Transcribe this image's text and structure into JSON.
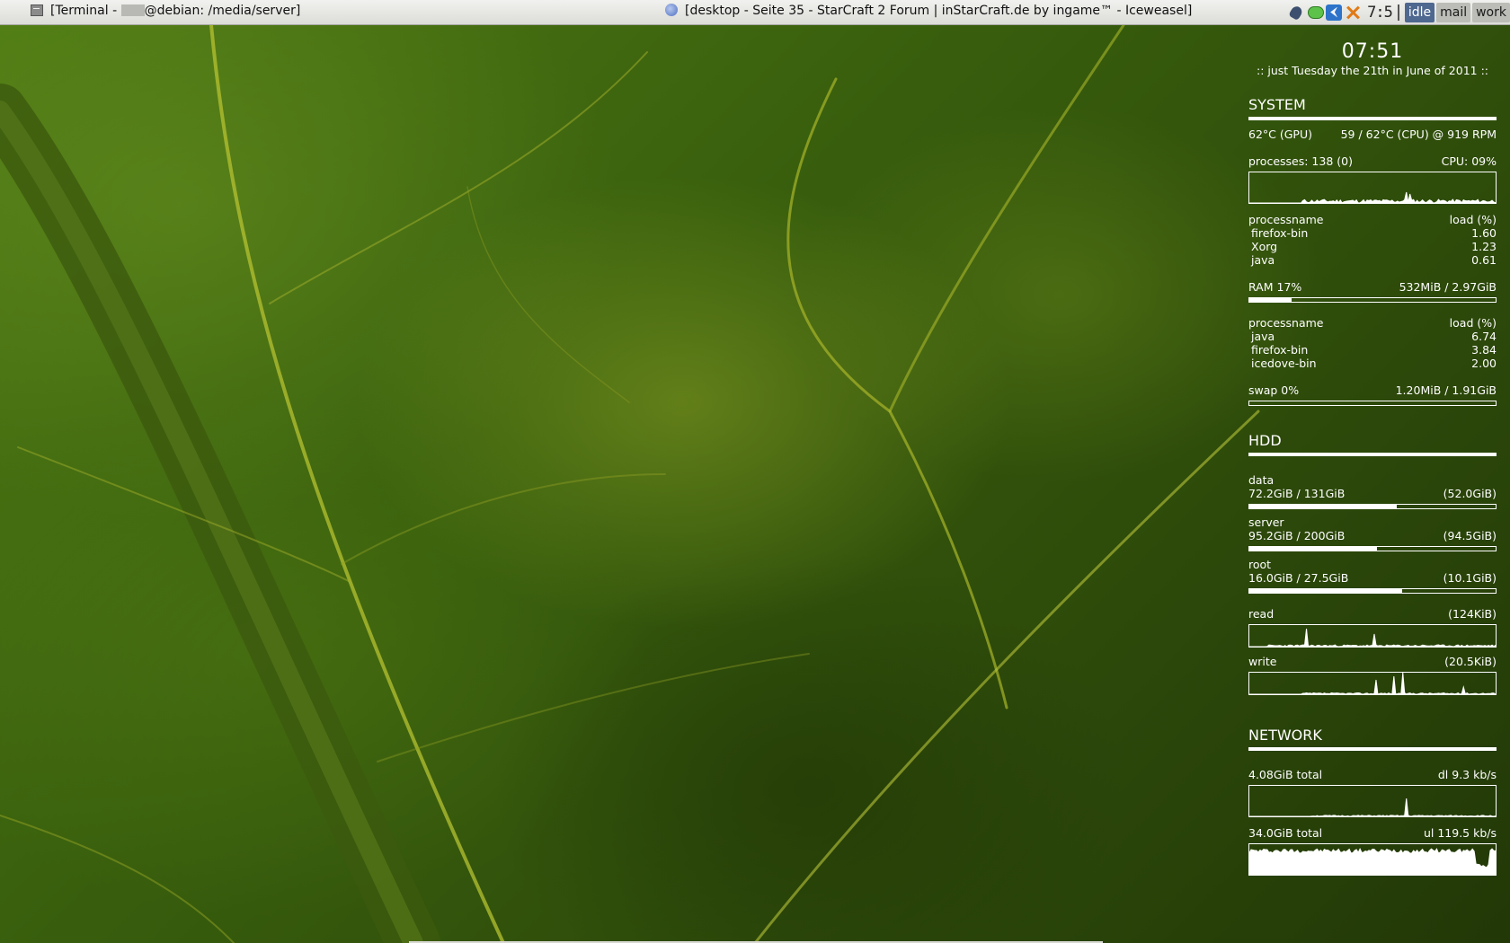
{
  "taskbar": {
    "terminal_title_prefix": "[Terminal - ",
    "terminal_title_suffix": "@debian: /media/server]",
    "browser_title": "[desktop - Seite 35 - StarCraft 2 Forum | inStarCraft.de by ingame™ - Iceweasel]"
  },
  "tray": {
    "clock": "7:5",
    "icons": [
      "wrench-icon",
      "chat-icon",
      "thunderbird-icon",
      "cross-icon"
    ],
    "tags": [
      {
        "label": "idle",
        "active": true
      },
      {
        "label": "mail",
        "active": false
      },
      {
        "label": "work",
        "active": false
      }
    ]
  },
  "conky": {
    "time": "07:51",
    "date": ":: just Tuesday the 21th in June of 2011 ::",
    "system": {
      "title": "SYSTEM",
      "gpu_temp": "62°C (GPU)",
      "cpu_temp": "59 / 62°C (CPU) @ 919 RPM",
      "processes": "processes: 138 (0)",
      "cpu": "CPU: 09%",
      "cpu_header": {
        "name": "processname",
        "load": "load (%)"
      },
      "cpu_procs": [
        {
          "name": "firefox-bin",
          "load": "1.60"
        },
        {
          "name": "Xorg",
          "load": "1.23"
        },
        {
          "name": "java",
          "load": "0.61"
        }
      ],
      "ram_label": "RAM 17%",
      "ram_value": "532MiB / 2.97GiB",
      "ram_pct": 17,
      "mem_header": {
        "name": "processname",
        "load": "load (%)"
      },
      "mem_procs": [
        {
          "name": "java",
          "load": "6.74"
        },
        {
          "name": "firefox-bin",
          "load": "3.84"
        },
        {
          "name": "icedove-bin",
          "load": "2.00"
        }
      ],
      "swap_label": "swap 0%",
      "swap_value": "1.20MiB / 1.91GiB",
      "swap_pct": 0
    },
    "hdd": {
      "title": "HDD",
      "disks": [
        {
          "name": "data",
          "usage": "72.2GiB / 131GiB",
          "free": "(52.0GiB)",
          "pct": 60
        },
        {
          "name": "server",
          "usage": "95.2GiB / 200GiB",
          "free": "(94.5GiB)",
          "pct": 52
        },
        {
          "name": "root",
          "usage": "16.0GiB / 27.5GiB",
          "free": "(10.1GiB)",
          "pct": 62
        }
      ],
      "read_label": "read",
      "read_value": "(124KiB)",
      "write_label": "write",
      "write_value": "(20.5KiB)"
    },
    "network": {
      "title": "NETWORK",
      "dl_total": "4.08GiB total",
      "dl_rate": "dl 9.3 kb/s",
      "ul_total": "34.0GiB total",
      "ul_rate": "ul 119.5 kb/s"
    }
  }
}
